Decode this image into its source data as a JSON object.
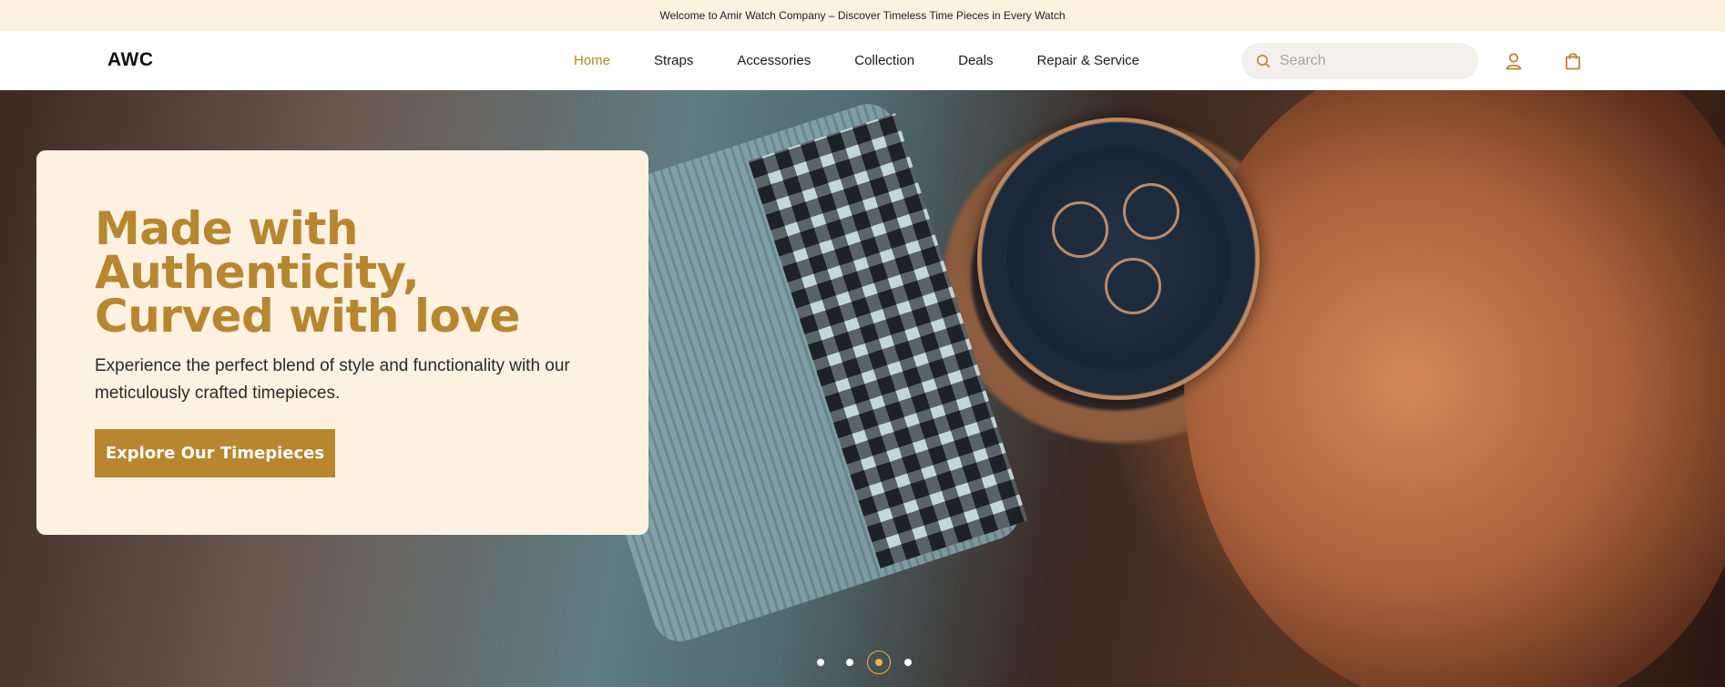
{
  "announcement": {
    "text": "Welcome to Amir Watch Company – Discover Timeless Time Pieces in Every Watch"
  },
  "header": {
    "logo": "AWC",
    "nav": [
      {
        "label": "Home",
        "active": true
      },
      {
        "label": "Straps",
        "active": false
      },
      {
        "label": "Accessories",
        "active": false
      },
      {
        "label": "Collection",
        "active": false
      },
      {
        "label": "Deals",
        "active": false
      },
      {
        "label": "Repair & Service",
        "active": false
      }
    ],
    "search": {
      "placeholder": "Search",
      "value": ""
    },
    "icons": [
      "search-icon",
      "user-icon",
      "shopping-bag-icon"
    ]
  },
  "hero": {
    "title": "Made with Authenticity, Curved with love",
    "subtitle": "Experience the perfect blend of style and functionality with our meticulously crafted timepieces.",
    "cta_label": "Explore Our Timepieces",
    "image": "wrist-watch-photo",
    "carousel": {
      "slide_count": 4,
      "active_index": 2
    }
  },
  "colors": {
    "accent": "#b8862e",
    "announcement_bg": "#fdf1e1",
    "card_bg": "#fdf1e1",
    "active_dot": "#f0b14a"
  }
}
